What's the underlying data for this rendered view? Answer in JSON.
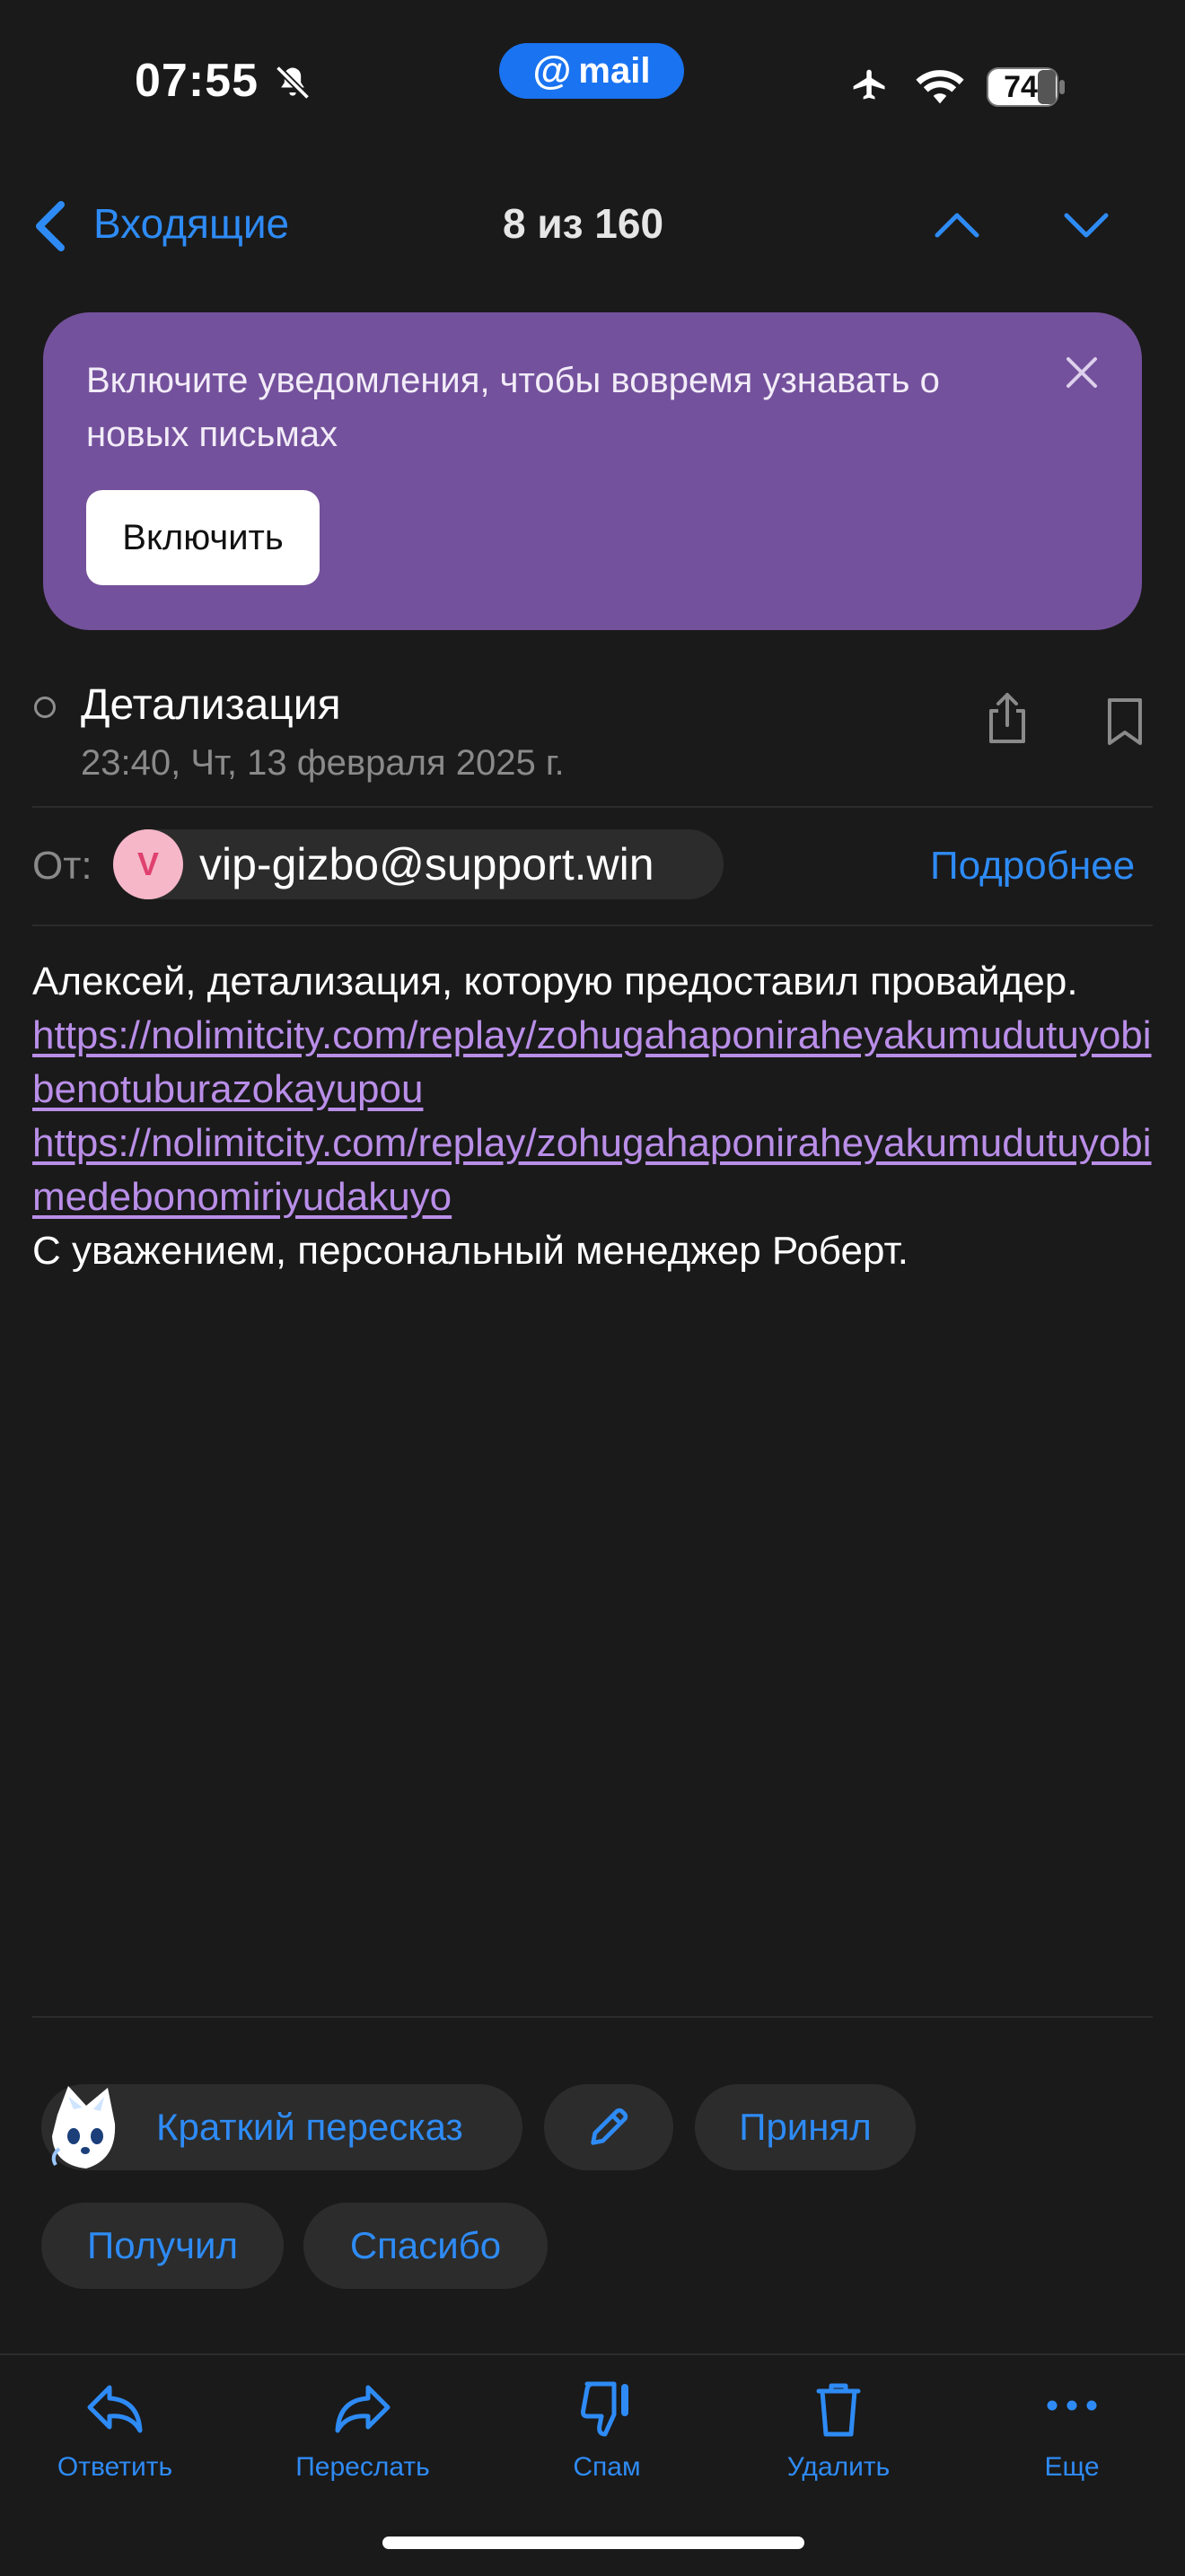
{
  "status_bar": {
    "time": "07:55",
    "brand": "mail",
    "brand_at": "@",
    "battery": "74",
    "icons": [
      "bell-muted-icon",
      "airplane-icon",
      "wifi-icon",
      "battery-icon"
    ]
  },
  "nav": {
    "back_label": "Входящие",
    "counter": "8 из 160"
  },
  "banner": {
    "text": "Включите уведомления, чтобы вовремя узнавать о новых письмах",
    "button": "Включить"
  },
  "message": {
    "subject": "Детализация",
    "date": "23:40, Чт, 13 февраля 2025 г.",
    "from_label": "От:",
    "from_initial": "V",
    "from_email": "vip-gizbo@support.win",
    "details_link": "Подробнее",
    "body_line1": "Алексей, детализация, которую предоставил провайдер.",
    "link1": "https://nolimitcity.com/replay/zohugahaponiraheyakumudutuyobibenotuburazokayupou",
    "link2": "https://nolimitcity.com/replay/zohugahaponiraheyakumudutuyobimedebonomiriyudakuyo",
    "body_closing": "С уважением, персональный менеджер Роберт."
  },
  "quick_replies": {
    "summary": "Краткий пересказ",
    "accept": "Принял",
    "got": "Получил",
    "thanks": "Спасибо"
  },
  "toolbar": {
    "reply": "Ответить",
    "forward": "Переслать",
    "spam": "Спам",
    "delete": "Удалить",
    "more": "Еще"
  },
  "colors": {
    "background": "#1a1a1a",
    "accent": "#2e8bf5",
    "banner": "#74519c",
    "link": "#b98ee8",
    "chip": "#2c2c2c"
  }
}
